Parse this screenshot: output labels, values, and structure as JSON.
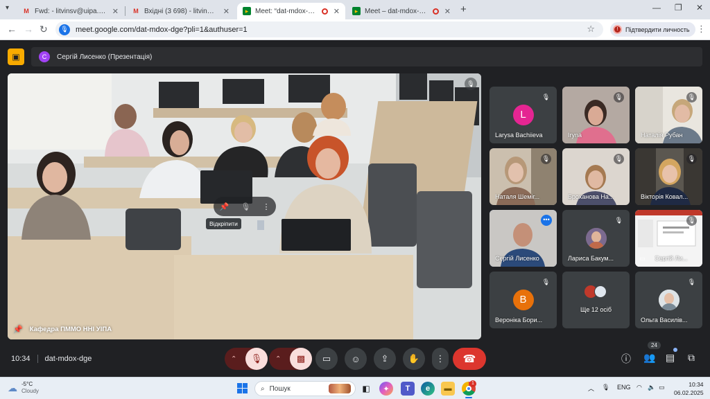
{
  "browser": {
    "tabs": [
      {
        "favicon": "gmail-icon",
        "title": "Fwd: - litvinsv@uipa.edu.ua - n",
        "active": false
      },
      {
        "favicon": "gmail-icon",
        "title": "Вхідні (3 698) - litvinov@uipa.e",
        "active": false
      },
      {
        "favicon": "meet-icon",
        "title": "Meet: “dat-mdox-dge”",
        "active": true,
        "recording": true
      },
      {
        "favicon": "meet-icon",
        "title": "Meet – dat-mdox-dge",
        "active": false,
        "recording": true
      }
    ],
    "url": "meet.google.com/dat-mdox-dge?pli=1&authuser=1",
    "verify_label": "Підтвердити личность"
  },
  "meet": {
    "presenter_bar": {
      "avatar_letter": "С",
      "label": "Сергій Лисенко (Презентація)"
    },
    "main_video": {
      "caption": "Кафедра ПММО ННІ УІПА",
      "tooltip": "Відкріпити"
    },
    "tiles": [
      {
        "name": "Larysa Bachiieva",
        "avatar_letter": "L",
        "avatar_color": "#e52592",
        "type": "avatar",
        "muted": true
      },
      {
        "name": "Iryna",
        "type": "video",
        "muted": true
      },
      {
        "name": "Наталія Рубан",
        "type": "video",
        "muted": true
      },
      {
        "name": "Наталя Шеміг...",
        "type": "video",
        "muted": true
      },
      {
        "name": "Броханова На...",
        "type": "video",
        "muted": true
      },
      {
        "name": "Вікторія Ковал...",
        "type": "video",
        "muted": true
      },
      {
        "name": "Сергій Лисенко",
        "type": "video",
        "speaking": true
      },
      {
        "name": "Лариса Бакум...",
        "type": "photo-avatar",
        "muted": true
      },
      {
        "name": "Сергій Ли...",
        "type": "presentation",
        "muted": true
      },
      {
        "name": "Вероніка Бори...",
        "avatar_letter": "В",
        "avatar_color": "#e8710a",
        "type": "avatar",
        "muted": true
      },
      {
        "name": "Ще 12 осіб",
        "type": "more"
      },
      {
        "name": "Ольга Василів...",
        "type": "photo-avatar",
        "muted": true
      }
    ],
    "time": "10:34",
    "meeting_code": "dat-mdox-dge",
    "participants_count": "24"
  },
  "taskbar": {
    "weather_temp": "-5°C",
    "weather_desc": "Cloudy",
    "search_label": "Пошук",
    "language": "ENG",
    "time": "10:34",
    "date": "06.02.2025",
    "chrome_badge": "1"
  }
}
